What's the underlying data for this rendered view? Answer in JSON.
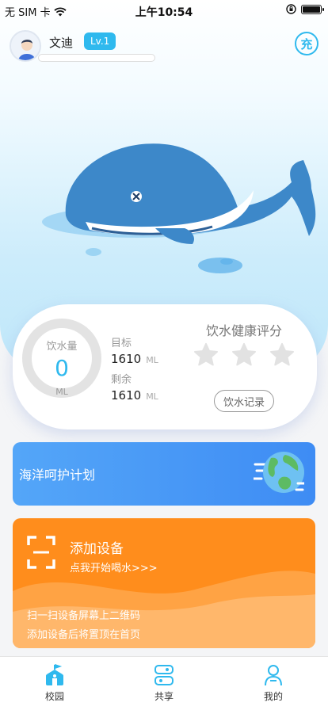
{
  "status_bar": {
    "carrier": "无 SIM 卡",
    "time": "上午10:54"
  },
  "user": {
    "name": "文迪",
    "level": "Lv.1",
    "exp_progress": 0.0
  },
  "header": {
    "recharge_label": "充"
  },
  "water": {
    "intake_label": "饮水量",
    "intake_value": "0",
    "intake_unit": "ML",
    "target_label": "目标",
    "target_value": "1610",
    "target_unit": "ML",
    "remain_label": "剩余",
    "remain_value": "1610",
    "remain_unit": "ML",
    "score_title": "饮水健康评分",
    "stars_filled": 0,
    "stars_total": 3,
    "record_button": "饮水记录"
  },
  "ocean_card": {
    "title": "海洋呵护计划"
  },
  "device_card": {
    "title": "添加设备",
    "subtitle": "点我开始喝水>>>",
    "line1": "扫一扫设备屏幕上二维码",
    "line2": "添加设备后将置顶在首页"
  },
  "tabs": [
    {
      "label": "校园",
      "icon": "campus-icon",
      "active": true
    },
    {
      "label": "共享",
      "icon": "share-icon",
      "active": false
    },
    {
      "label": "我的",
      "icon": "profile-icon",
      "active": false
    }
  ],
  "colors": {
    "accent": "#2fb9ee",
    "ocean_card": "#3e8cf4",
    "device_card": "#ff8d1c",
    "whale": "#3d88c9"
  }
}
